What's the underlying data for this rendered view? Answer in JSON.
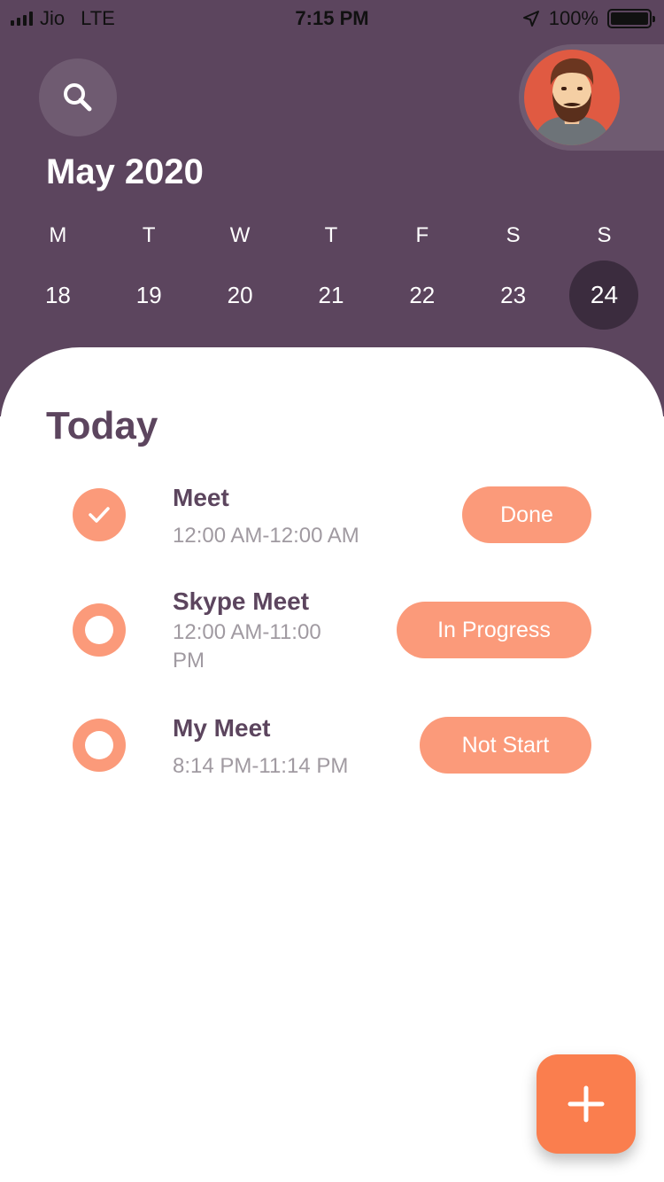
{
  "status_bar": {
    "carrier": "Jio",
    "network": "LTE",
    "time": "7:15 PM",
    "battery": "100%"
  },
  "icons": {
    "search": "search-icon",
    "location": "location-arrow-icon",
    "add": "plus-icon",
    "check": "checkmark-icon"
  },
  "calendar": {
    "month_label": "May 2020",
    "weekdays": [
      "M",
      "T",
      "W",
      "T",
      "F",
      "S",
      "S"
    ],
    "dates": [
      "18",
      "19",
      "20",
      "21",
      "22",
      "23",
      "24"
    ],
    "selected_date": "24"
  },
  "today_label": "Today",
  "tasks": [
    {
      "title": "Meet",
      "time": "12:00 AM-12:00 AM",
      "status": "Done",
      "completed": true
    },
    {
      "title": "Skype Meet",
      "time_line1": "12:00 AM-11:00",
      "time_line2": "PM",
      "status": "In Progress",
      "completed": false
    },
    {
      "title": "My Meet",
      "time": "8:14 PM-11:14 PM",
      "status": "Not Start",
      "completed": false
    }
  ],
  "colors": {
    "header_bg": "#5c455e",
    "selected_date_bg": "#3b2c3e",
    "accent": "#fb9a7a",
    "fab": "#fa7e4e",
    "title_text": "#5c455e",
    "muted_text": "#a09aa1"
  }
}
